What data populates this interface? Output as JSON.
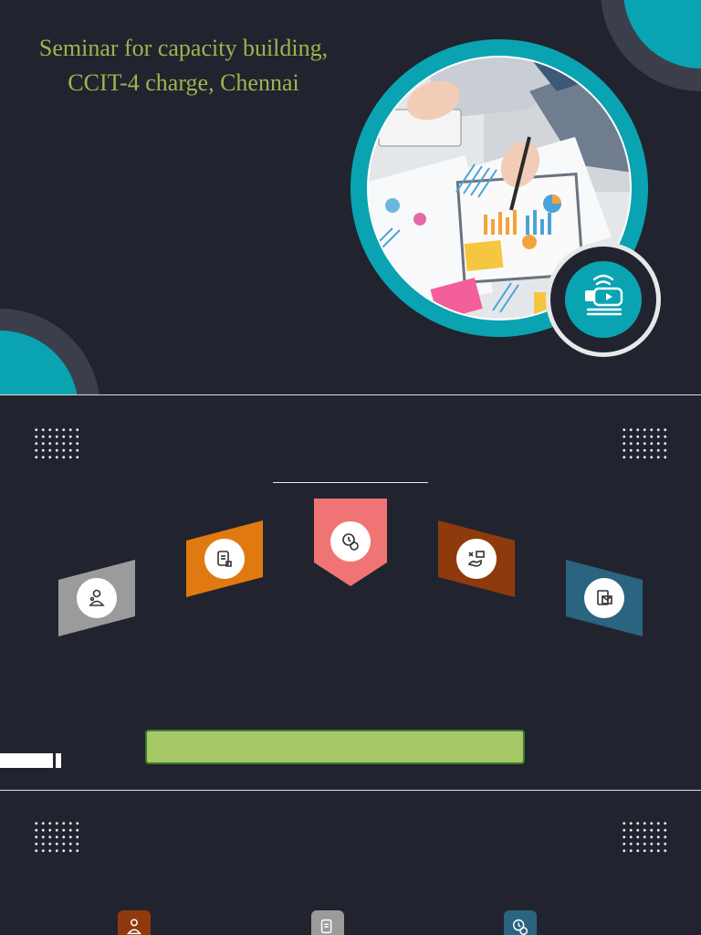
{
  "slide1": {
    "title_line1": "Seminar for capacity building,",
    "title_line2": "CCIT-4 charge, Chennai",
    "accent_color": "#0aa3b1",
    "title_color": "#9fb34e",
    "badge_icon": "video-conference-icon"
  },
  "slide2": {
    "ribbons": [
      {
        "color": "#9b9b9b",
        "icon": "user-network-icon"
      },
      {
        "color": "#e07a10",
        "icon": "document-edit-icon"
      },
      {
        "color": "#f07474",
        "icon": "clock-coins-icon"
      },
      {
        "color": "#8f3a0c",
        "icon": "hand-cost-icon"
      },
      {
        "color": "#2a6480",
        "icon": "envelope-document-icon"
      }
    ],
    "bar_color": "#a6c867"
  },
  "slide3": {
    "squares": [
      {
        "color": "#8f3a0c",
        "icon": "user-network-icon"
      },
      {
        "color": "#9b9b9b",
        "icon": "document-edit-icon"
      },
      {
        "color": "#2a6480",
        "icon": "clock-coins-icon"
      }
    ]
  }
}
